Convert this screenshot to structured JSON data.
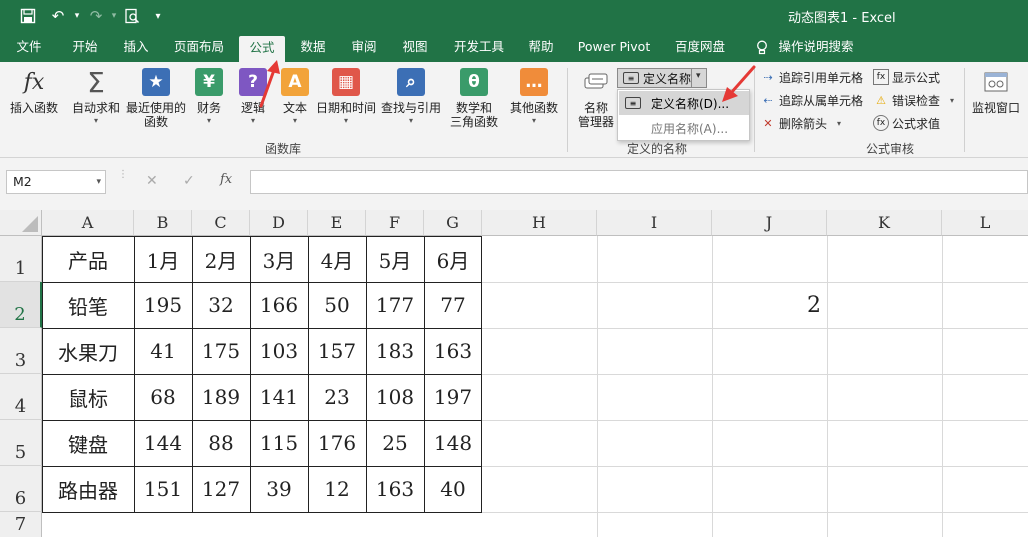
{
  "window": {
    "title": "动态图表1  -  Excel"
  },
  "tabs": [
    "文件",
    "开始",
    "插入",
    "页面布局",
    "公式",
    "数据",
    "审阅",
    "视图",
    "开发工具",
    "帮助",
    "Power Pivot",
    "百度网盘",
    "操作说明搜索"
  ],
  "ribbon": {
    "function_library": {
      "label": "函数库",
      "buttons": [
        "插入函数",
        "自动求和",
        "最近使用的\n函数",
        "财务",
        "逻辑",
        "文本",
        "日期和时间",
        "查找与引用",
        "数学和\n三角函数",
        "其他函数"
      ]
    },
    "defined_names": {
      "label": "定义的名称",
      "name_manager": "名称\n管理器",
      "define_name": "定义名称",
      "menu_items": [
        "定义名称(D)...",
        "应用名称(A)..."
      ]
    },
    "formula_auditing": {
      "label": "公式审核",
      "items": [
        "追踪引用单元格",
        "追踪从属单元格",
        "删除箭头",
        "显示公式",
        "错误检查",
        "公式求值"
      ],
      "watch_window": "监视窗口"
    }
  },
  "formula_bar": {
    "name_box": "M2",
    "fx": "fx",
    "value": ""
  },
  "sheet": {
    "columns": [
      "A",
      "B",
      "C",
      "D",
      "E",
      "F",
      "G",
      "H",
      "I",
      "J",
      "K",
      "L"
    ],
    "rows": [
      "1",
      "2",
      "3",
      "4",
      "5",
      "6",
      "7"
    ],
    "table": [
      [
        "产品",
        "1月",
        "2月",
        "3月",
        "4月",
        "5月",
        "6月"
      ],
      [
        "铅笔",
        "195",
        "32",
        "166",
        "50",
        "177",
        "77"
      ],
      [
        "水果刀",
        "41",
        "175",
        "103",
        "157",
        "183",
        "163"
      ],
      [
        "鼠标",
        "68",
        "189",
        "141",
        "23",
        "108",
        "197"
      ],
      [
        "键盘",
        "144",
        "88",
        "115",
        "176",
        "25",
        "148"
      ],
      [
        "路由器",
        "151",
        "127",
        "39",
        "12",
        "163",
        "40"
      ]
    ],
    "j2_value": "2"
  },
  "colors": {
    "accent": "#217346",
    "annotation_arrow": "#e53935"
  }
}
